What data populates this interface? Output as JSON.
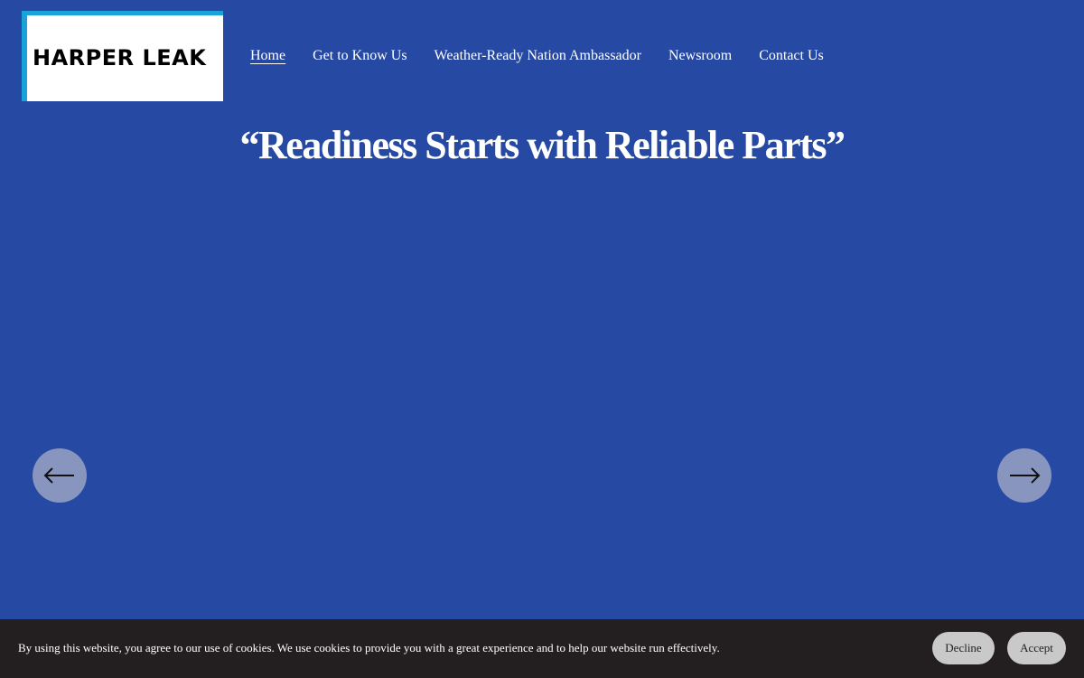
{
  "logo": {
    "text": "HARPER LEAK"
  },
  "nav": {
    "items": [
      {
        "label": "Home",
        "active": true
      },
      {
        "label": "Get to Know Us",
        "active": false
      },
      {
        "label": "Weather-Ready Nation Ambassador",
        "active": false
      },
      {
        "label": "Newsroom",
        "active": false
      },
      {
        "label": "Contact Us",
        "active": false
      }
    ]
  },
  "hero": {
    "title": "“Readiness Starts with Reliable Parts”"
  },
  "slider": {
    "prev_icon": "arrow-left-icon",
    "next_icon": "arrow-right-icon"
  },
  "cookie": {
    "message": "By using this website, you agree to our use of cookies. We use cookies to provide you with a great experience and to help our website run effectively.",
    "decline_label": "Decline",
    "accept_label": "Accept"
  },
  "colors": {
    "background": "#2649a3",
    "logo_accent": "#1aa3d8",
    "cookie_bar": "#231f20",
    "cookie_button": "#c9c9c9"
  }
}
